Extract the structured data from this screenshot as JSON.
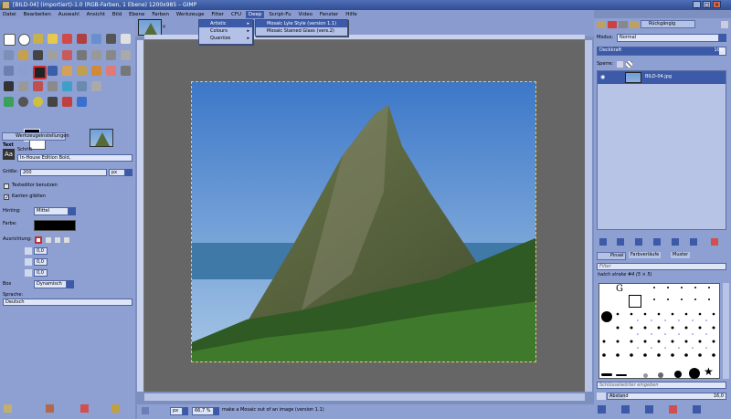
{
  "window": {
    "title": "[BILD-04] (importiert)-1.0 (RGB-Farben, 1 Ebene) 1200x985 – GIMP",
    "minimize": "_",
    "maximize": "□",
    "close": "×"
  },
  "menubar": {
    "items": [
      "Datei",
      "Bearbeiten",
      "Auswahl",
      "Ansicht",
      "Bild",
      "Ebene",
      "Farben",
      "Werkzeuge",
      "Filter",
      "CFU",
      "Deep",
      "Script-Fu",
      "Video",
      "Fenster",
      "Hilfe"
    ],
    "active_index": 10
  },
  "dropdown": {
    "items": [
      {
        "label": "Artistic",
        "highlighted": true
      },
      {
        "label": "Colours",
        "highlighted": false
      },
      {
        "label": "Quantize",
        "highlighted": false
      }
    ],
    "submenu": [
      {
        "label": "Mosaic Lyle Style (version 1.1)",
        "highlighted": true
      },
      {
        "label": "Mosaic Stained Glass (vers.2)",
        "highlighted": false
      }
    ]
  },
  "tool_options": {
    "tab_label": "Werkzeugeinstellungen",
    "tool_name": "Text",
    "font_label": "Schrift",
    "font_value": "In-House Edition Bold,",
    "size_label": "Größe:",
    "size_value": "200",
    "size_unit": "px",
    "texteditor_label": "Texteditor benutzen",
    "antialias_label": "Kanten glätten",
    "hinting_label": "Hinting:",
    "hinting_value": "Mittel",
    "color_label": "Farbe:",
    "justify_label": "Ausrichtung:",
    "indent_value": "0,0",
    "linespacing_value": "0,0",
    "letterspacing_value": "0,0",
    "box_label": "Box",
    "box_value": "Dynamisch",
    "language_label": "Sprache:",
    "language_value": "Deutsch"
  },
  "status": {
    "unit": "px",
    "zoom": "66,7 %",
    "message": "make a Mosaic out of an image (version 1.1)"
  },
  "layers": {
    "tab_label": "Rückgängig",
    "mode_label": "Modus:",
    "mode_value": "Normal",
    "opacity_label": "Deckkraft",
    "opacity_value": "100",
    "lock_label": "Sperre:",
    "layer_name": "BILD-04.jpg"
  },
  "brushes": {
    "tabs": [
      "Pinsel",
      "Farbverläufe",
      "Muster"
    ],
    "filter_placeholder": "Filter",
    "current_brush": "hatch stroke #4 (5 × 5)",
    "tag_placeholder": "Schlüsselwörter eingeben",
    "spacing_label": "Abstand",
    "spacing_value": "16,0"
  },
  "colors": {
    "accent": "#3d5aa8",
    "panel": "#8e9fd2",
    "canvas_bg": "#666666"
  }
}
